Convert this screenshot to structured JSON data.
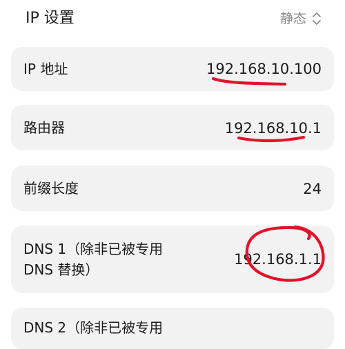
{
  "header": {
    "title": "IP 设置",
    "mode_value": "静态"
  },
  "fields": {
    "ip_address": {
      "label": "IP 地址",
      "value": "192.168.10.100"
    },
    "router": {
      "label": "路由器",
      "value": "192.168.10.1"
    },
    "prefix_length": {
      "label": "前缀长度",
      "value": "24"
    },
    "dns1": {
      "label_line1": "DNS 1（除非已被专用",
      "label_line2": "DNS 替换）",
      "value": "192.168.1.1"
    },
    "dns2": {
      "label_line1": "DNS 2（除非已被专用"
    }
  },
  "colors": {
    "card_background": "#f2f2f2",
    "secondary_text": "#8a8a8a",
    "annotation_red": "#e0132a"
  },
  "icons": {
    "mode_selector": "chevron-up-down-icon"
  }
}
